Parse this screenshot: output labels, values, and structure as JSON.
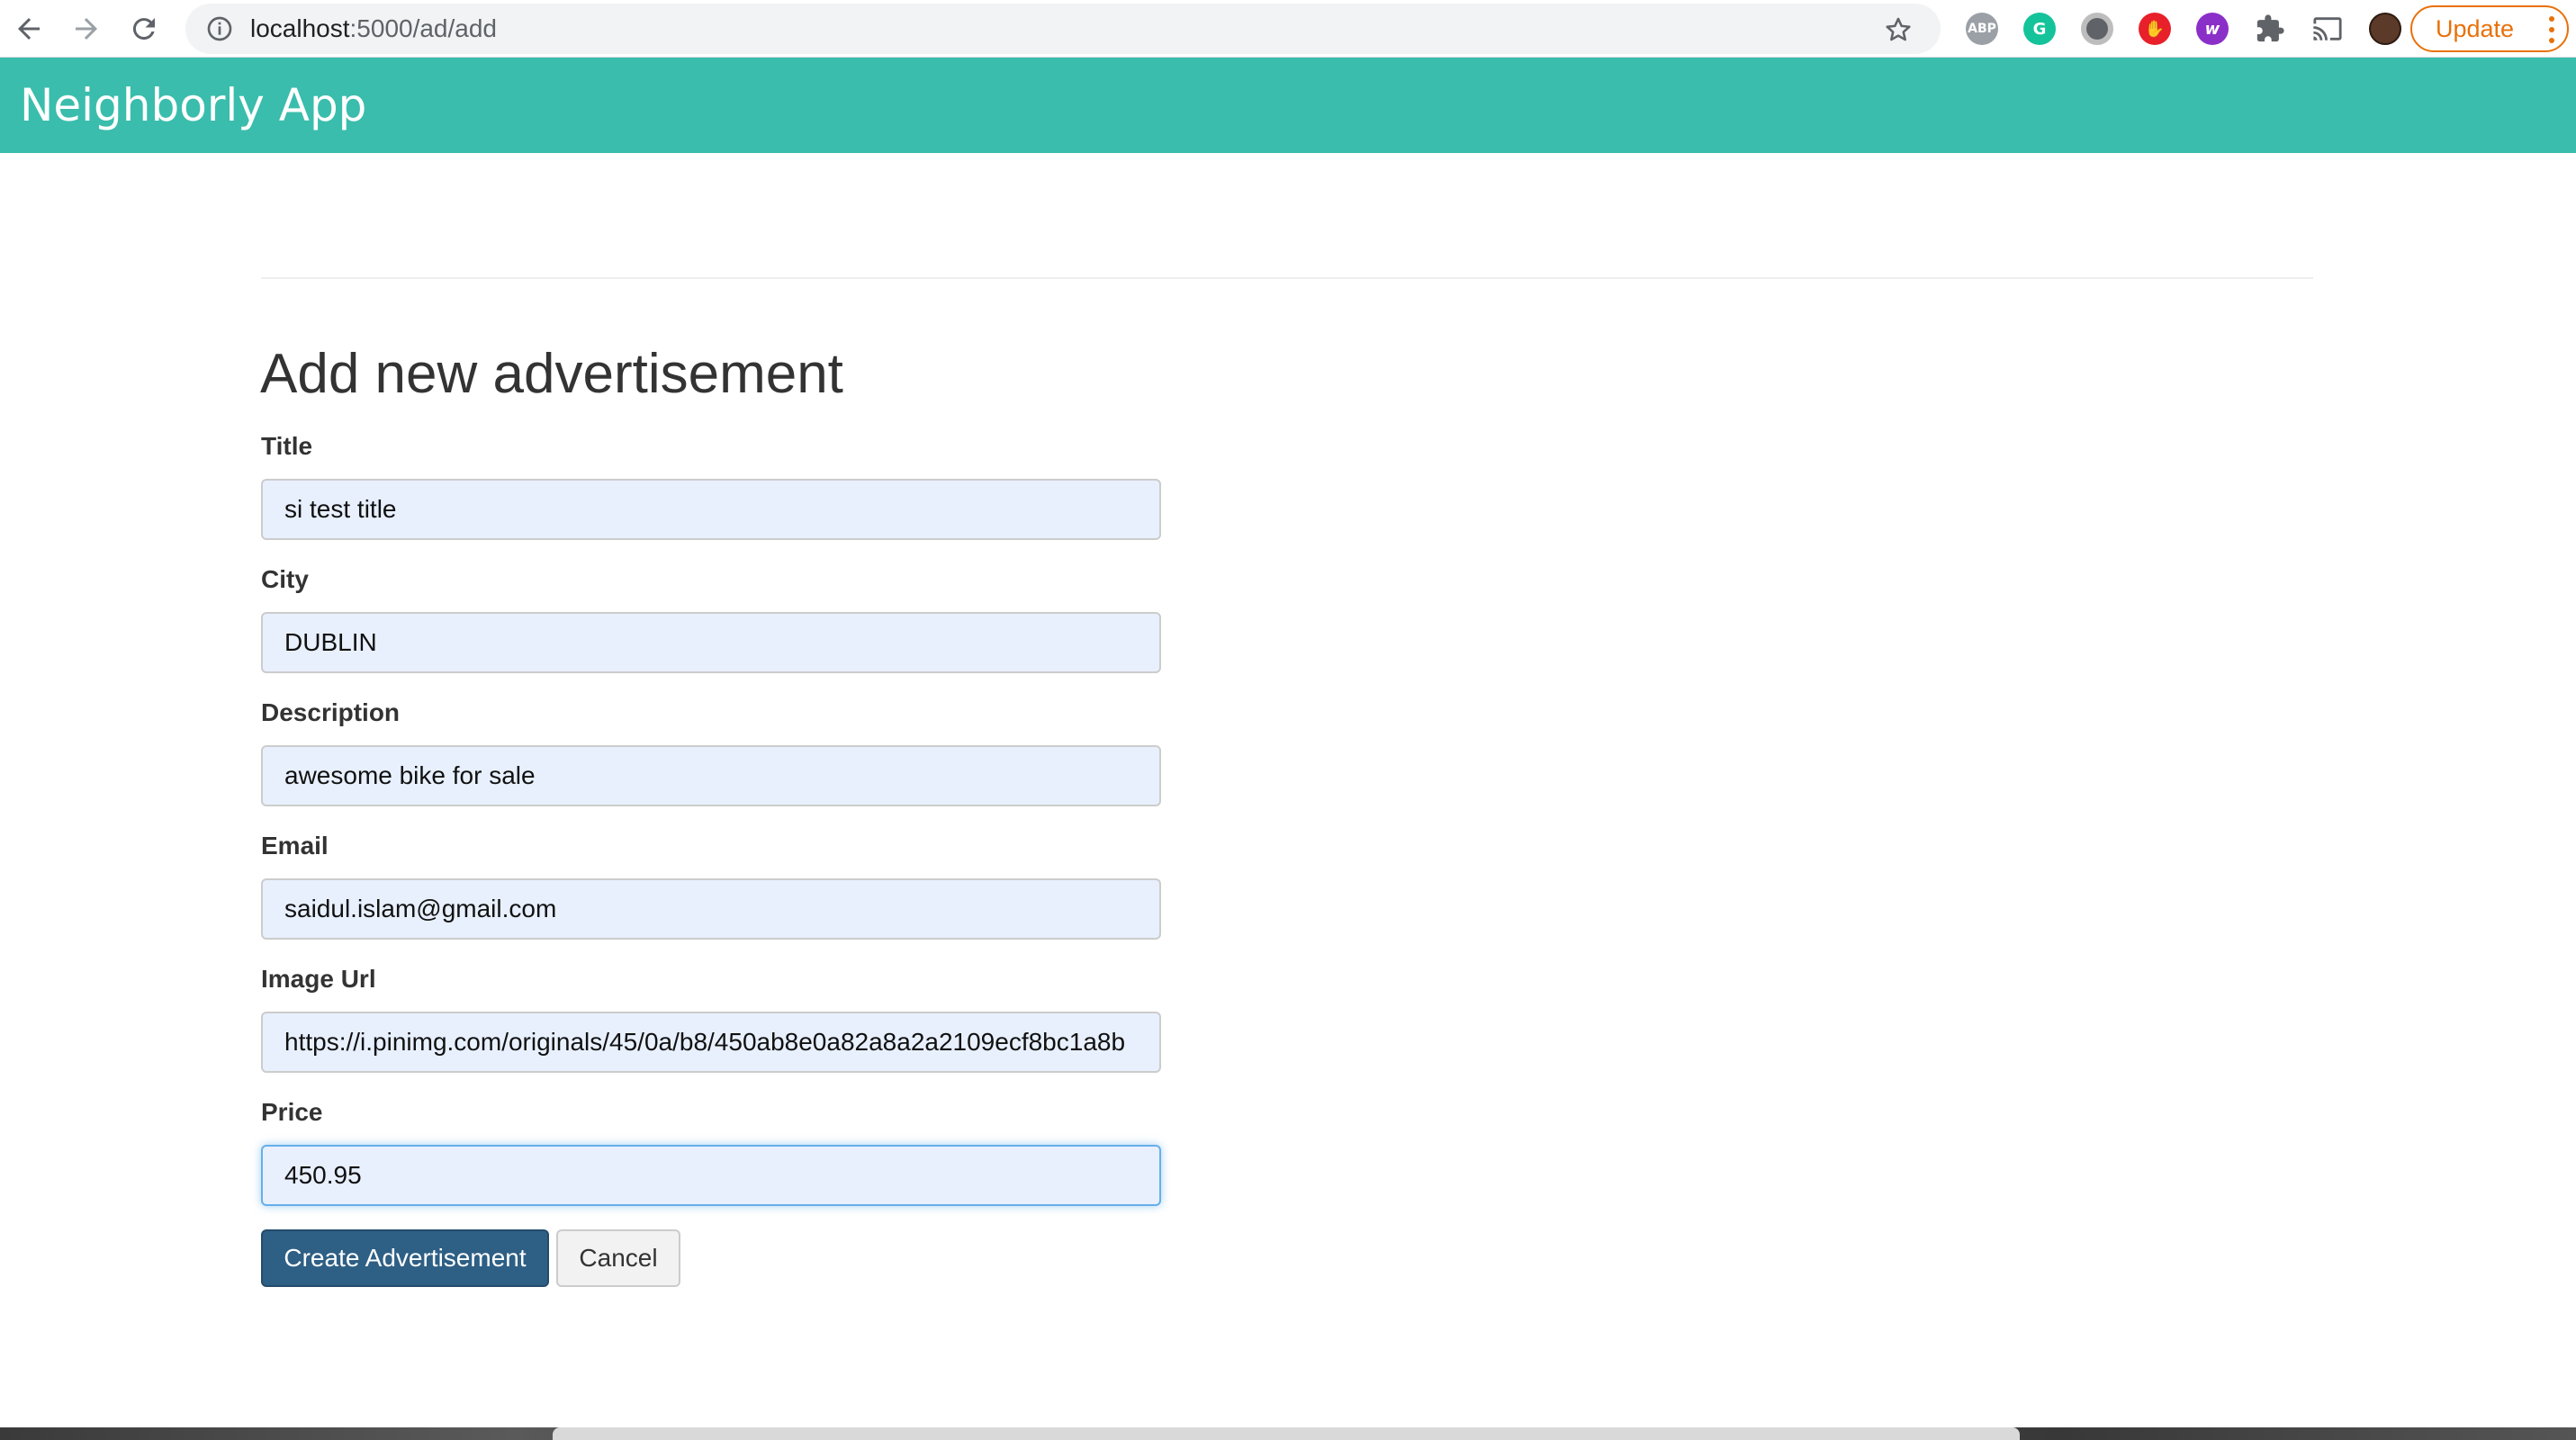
{
  "browser": {
    "url_host": "localhost",
    "url_rest": ":5000/ad/add",
    "update_label": "Update",
    "extensions": [
      {
        "name": "adblock-plus-icon",
        "label": "ABP",
        "color": "#9aa0a6"
      },
      {
        "name": "grammarly-icon",
        "label": "G",
        "color": "#15c39a"
      },
      {
        "name": "privacy-ext-icon",
        "label": "",
        "color": "#5f6368"
      },
      {
        "name": "adblock-icon",
        "label": "✋",
        "color": "#e8202a"
      },
      {
        "name": "ext-w-icon",
        "label": "w",
        "color": "#8b2fc9"
      }
    ]
  },
  "navbar": {
    "brand": "Neighborly App",
    "color": "#3abdac"
  },
  "page": {
    "title": "Add new advertisement"
  },
  "form": {
    "fields": [
      {
        "label": "Title",
        "value": "si test title"
      },
      {
        "label": "City",
        "value": "DUBLIN"
      },
      {
        "label": "Description",
        "value": "awesome bike for sale"
      },
      {
        "label": "Email",
        "value": "saidul.islam@gmail.com"
      },
      {
        "label": "Image Url",
        "value": "https://i.pinimg.com/originals/45/0a/b8/450ab8e0a82a8a2a2109ecf8bc1a8b"
      },
      {
        "label": "Price",
        "value": "450.95"
      }
    ],
    "submit_label": "Create Advertisement",
    "cancel_label": "Cancel"
  }
}
